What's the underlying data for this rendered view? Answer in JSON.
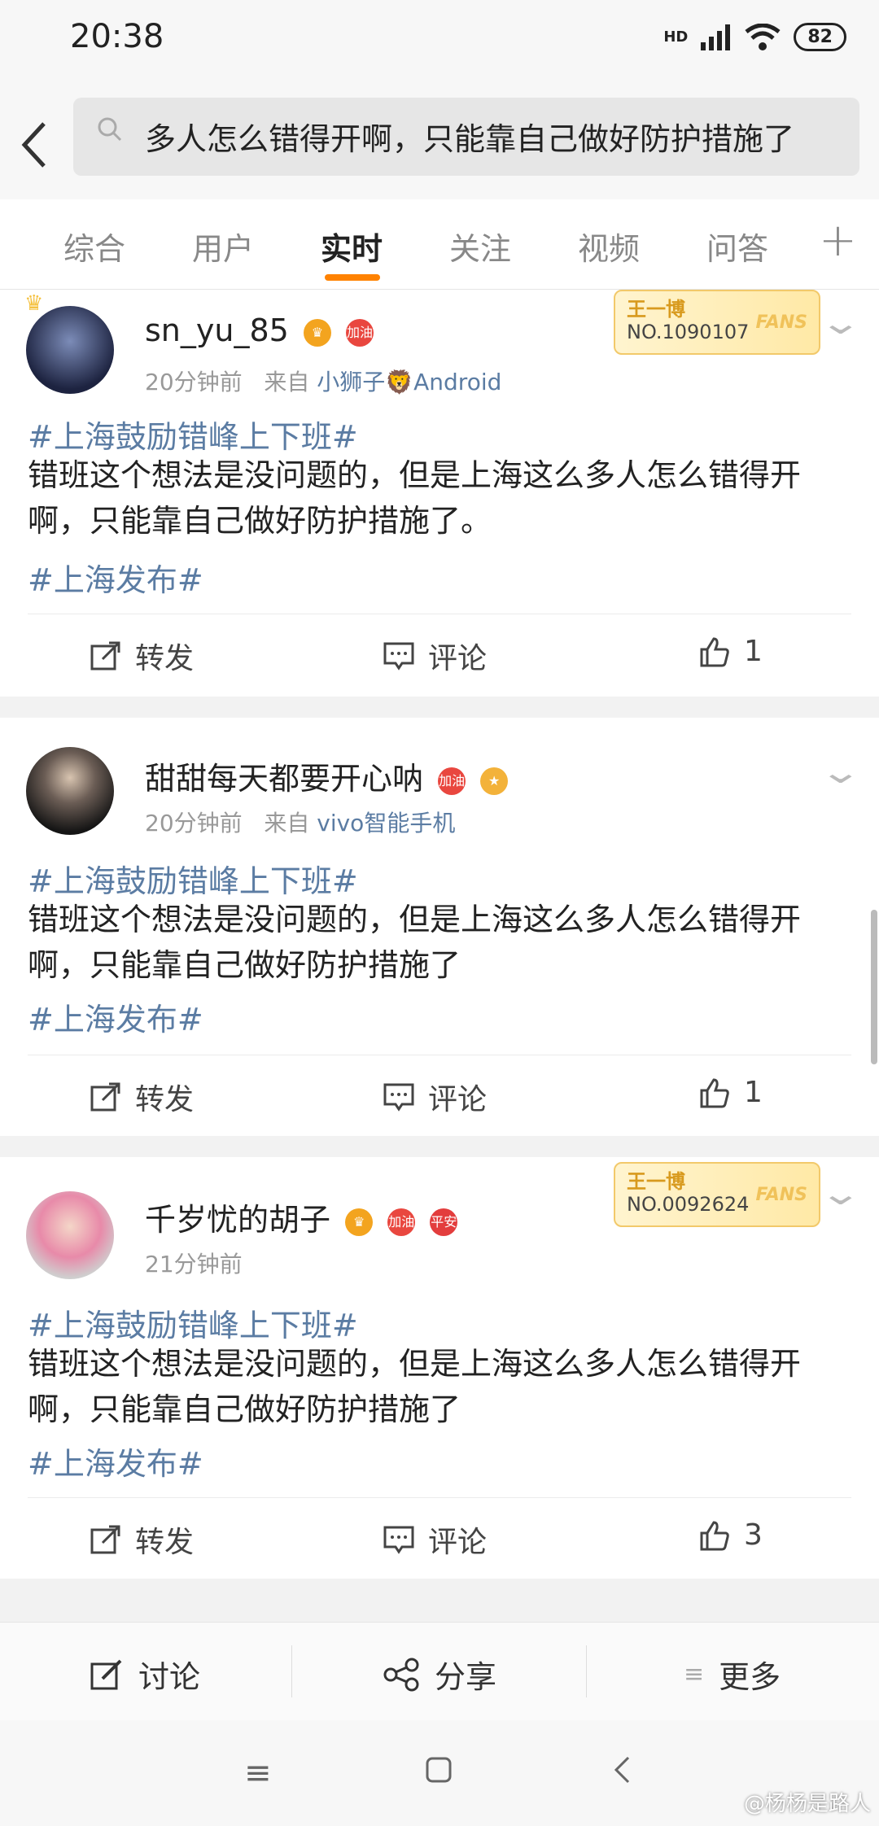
{
  "status": {
    "time": "20:38",
    "hd": "HD",
    "battery": "82"
  },
  "search": {
    "query": "多人怎么错得开啊，只能靠自己做好防护措施了"
  },
  "tabs": [
    "综合",
    "用户",
    "实时",
    "关注",
    "视频",
    "问答"
  ],
  "posts": [
    {
      "user": "sn_yu_85",
      "time": "20分钟前",
      "from_label": "来自",
      "source": "小狮子🦁Android",
      "topic1": "#上海鼓励错峰上下班#",
      "body": "错班这个想法是没问题的，但是上海这么多人怎么错得开啊，只能靠自己做好防护措施了。",
      "topic2": "#上海发布#",
      "repost": "转发",
      "comment": "评论",
      "likes": "1",
      "fans_name": "王一博",
      "fans_no": "NO.1090107",
      "fans_tag": "FANS"
    },
    {
      "user": "甜甜每天都要开心呐",
      "time": "20分钟前",
      "from_label": "来自",
      "source": "vivo智能手机",
      "topic1": "#上海鼓励错峰上下班#",
      "body": "错班这个想法是没问题的，但是上海这么多人怎么错得开啊，只能靠自己做好防护措施了",
      "topic2": "#上海发布#",
      "repost": "转发",
      "comment": "评论",
      "likes": "1"
    },
    {
      "user": "千岁忧的胡子",
      "time": "21分钟前",
      "topic1": "#上海鼓励错峰上下班#",
      "body": "错班这个想法是没问题的，但是上海这么多人怎么错得开啊，只能靠自己做好防护措施了",
      "topic2": "#上海发布#",
      "repost": "转发",
      "comment": "评论",
      "likes": "3",
      "fans_name": "王一博",
      "fans_no": "NO.0092624",
      "fans_tag": "FANS"
    }
  ],
  "badges": {
    "jiayou": "加油",
    "ping_an": "平安"
  },
  "bottom": {
    "discuss": "讨论",
    "share": "分享",
    "more": "更多"
  },
  "watermark": "@杨杨是路人",
  "colors": {
    "accent": "#ff8200",
    "topic": "#5b7ca3"
  }
}
